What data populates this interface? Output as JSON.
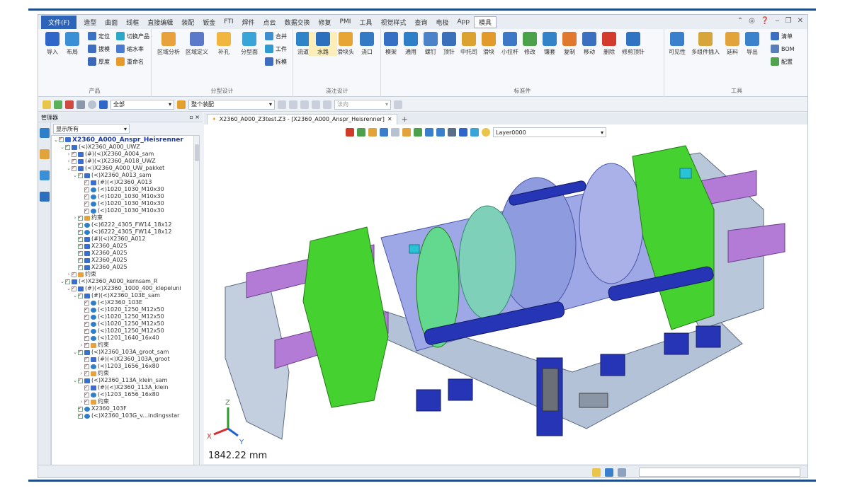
{
  "menubar": {
    "file_label": "文件(F)",
    "items": [
      "造型",
      "曲面",
      "线框",
      "直接编辑",
      "装配",
      "钣金",
      "FTI",
      "焊件",
      "点云",
      "数据交换",
      "修复",
      "PMI",
      "工具",
      "视觉样式",
      "查询",
      "电极",
      "App"
    ],
    "active_tab": "模具"
  },
  "ribbon": {
    "groups": [
      {
        "label": "产品",
        "buttons": [
          "导入",
          "布局"
        ],
        "small": [
          "定位",
          "切换产品",
          "拔模",
          "缩水率",
          "厚度",
          "重命名"
        ]
      },
      {
        "label": "分型设计",
        "buttons": [
          "区域分析",
          "区域定义",
          "补孔",
          "分型面"
        ],
        "small": [
          "合并",
          "工件",
          "拆模"
        ]
      },
      {
        "label": "浇注设计",
        "buttons": [
          "流道",
          "水路",
          "滑块头",
          "浇口"
        ]
      },
      {
        "label": "标准件",
        "buttons": [
          "模架",
          "通用",
          "螺钉",
          "顶针",
          "中托司",
          "滑块",
          "小拉杆",
          "修改",
          "镶套",
          "复制",
          "移动",
          "删除",
          "修剪顶针"
        ]
      },
      {
        "label": "工具",
        "buttons": [
          "可见性",
          "多组件插入",
          "延料",
          "导出"
        ],
        "small": [
          "清单",
          "BOM",
          "配置"
        ]
      }
    ]
  },
  "toolbar": {
    "filter_value": "全部",
    "scope_value": "整个装配",
    "direction_placeholder": "法向"
  },
  "manager": {
    "title": "管理器",
    "filter_value": "显示所有",
    "tree": [
      {
        "indent": 0,
        "type": "asm",
        "label": "X2360_A000_Anspr_Heisrenner",
        "toggle": "v",
        "root": true
      },
      {
        "indent": 1,
        "type": "asm",
        "label": "(<)X2360_A000_UWZ",
        "toggle": "v"
      },
      {
        "indent": 2,
        "type": "asm",
        "label": "(#)(<)X2360_A004_sam",
        "toggle": ">"
      },
      {
        "indent": 2,
        "type": "asm",
        "label": "(#)(<)X2360_A018_UWZ",
        "toggle": ">"
      },
      {
        "indent": 2,
        "type": "asm",
        "label": "(<)X2360_A000_UW_pakket",
        "toggle": "v"
      },
      {
        "indent": 3,
        "type": "asm",
        "label": "(<)X2360_A013_sam",
        "toggle": "v"
      },
      {
        "indent": 4,
        "type": "asm",
        "label": "(#)(<)X2360_A013",
        "toggle": ""
      },
      {
        "indent": 4,
        "type": "part",
        "label": "(<)1020_1030_M10x30",
        "toggle": ""
      },
      {
        "indent": 4,
        "type": "part",
        "label": "(<)1020_1030_M10x30",
        "toggle": ""
      },
      {
        "indent": 4,
        "type": "part",
        "label": "(<)1020_1030_M10x30",
        "toggle": ""
      },
      {
        "indent": 4,
        "type": "part",
        "label": "(<)1020_1030_M10x30",
        "toggle": ""
      },
      {
        "indent": 3,
        "type": "fld",
        "label": "约束",
        "toggle": ">"
      },
      {
        "indent": 3,
        "type": "part",
        "label": "(<)6222_4305_FW14_18x12",
        "toggle": ""
      },
      {
        "indent": 3,
        "type": "part",
        "label": "(<)6222_4305_FW14_18x12",
        "toggle": ""
      },
      {
        "indent": 3,
        "type": "asm",
        "label": "(#)(<)X2360_A012",
        "toggle": ""
      },
      {
        "indent": 3,
        "type": "asm",
        "label": "X2360_A025",
        "toggle": ""
      },
      {
        "indent": 3,
        "type": "asm",
        "label": "X2360_A025",
        "toggle": ""
      },
      {
        "indent": 3,
        "type": "asm",
        "label": "X2360_A025",
        "toggle": ""
      },
      {
        "indent": 3,
        "type": "asm",
        "label": "X2360_A025",
        "toggle": ""
      },
      {
        "indent": 2,
        "type": "fld",
        "label": "约束",
        "toggle": ">"
      },
      {
        "indent": 1,
        "type": "asm",
        "label": "(<)X2360_A000_kernsam_R",
        "toggle": "v"
      },
      {
        "indent": 2,
        "type": "asm",
        "label": "(#)(<)X2360_1000_400_klepeluni",
        "toggle": "v"
      },
      {
        "indent": 3,
        "type": "asm",
        "label": "(#)(<)X2360_103E_sam",
        "toggle": "v"
      },
      {
        "indent": 4,
        "type": "part",
        "label": "(<)X2360_103E",
        "toggle": ""
      },
      {
        "indent": 4,
        "type": "part",
        "label": "(<)1020_1250_M12x50",
        "toggle": ""
      },
      {
        "indent": 4,
        "type": "part",
        "label": "(<)1020_1250_M12x50",
        "toggle": ""
      },
      {
        "indent": 4,
        "type": "part",
        "label": "(<)1020_1250_M12x50",
        "toggle": ""
      },
      {
        "indent": 4,
        "type": "part",
        "label": "(<)1020_1250_M12x50",
        "toggle": ""
      },
      {
        "indent": 4,
        "type": "part",
        "label": "(<)1201_1640_16x40",
        "toggle": ""
      },
      {
        "indent": 4,
        "type": "fld",
        "label": "约束",
        "toggle": ">"
      },
      {
        "indent": 3,
        "type": "asm",
        "label": "(<)X2360_103A_groot_sam",
        "toggle": "v"
      },
      {
        "indent": 4,
        "type": "asm",
        "label": "(#)(<)X2360_103A_groot",
        "toggle": ""
      },
      {
        "indent": 4,
        "type": "part",
        "label": "(<)1203_1656_16x80",
        "toggle": ""
      },
      {
        "indent": 4,
        "type": "fld",
        "label": "约束",
        "toggle": ">"
      },
      {
        "indent": 3,
        "type": "asm",
        "label": "(<)X2360_113A_klein_sam",
        "toggle": "v"
      },
      {
        "indent": 4,
        "type": "asm",
        "label": "(#)(<)X2360_113A_klein",
        "toggle": ""
      },
      {
        "indent": 4,
        "type": "part",
        "label": "(<)1203_1656_16x80",
        "toggle": ""
      },
      {
        "indent": 4,
        "type": "fld",
        "label": "约束",
        "toggle": ">"
      },
      {
        "indent": 3,
        "type": "part",
        "label": "X2360_103F",
        "toggle": ""
      },
      {
        "indent": 3,
        "type": "part",
        "label": "(<)X2360_103G_v...indingsstar",
        "toggle": ""
      }
    ]
  },
  "document_tab": {
    "label": "X2360_A000_Z3test.Z3 - [X2360_A000_Anspr_Heisrenner]"
  },
  "viewport": {
    "layer_value": "Layer0000",
    "scale_readout": "1842.22 mm",
    "axis_labels": [
      "X",
      "Y",
      "Z"
    ]
  },
  "colors": {
    "accent": "#2e64b8",
    "frame_line": "#1f4d8a",
    "model_green": "#45d12f",
    "model_steel": "#aebed3",
    "model_purple": "#b37bd6",
    "model_blue": "#2635b5"
  }
}
